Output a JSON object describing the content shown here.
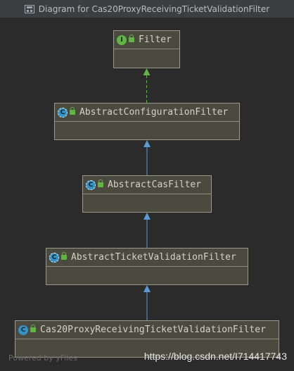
{
  "window": {
    "title": "Diagram for Cas20ProxyReceivingTicketValidationFilter"
  },
  "nodes": [
    {
      "id": "filter",
      "name": "Filter",
      "kind": "interface",
      "badge": "I"
    },
    {
      "id": "acf",
      "name": "AbstractConfigurationFilter",
      "kind": "abstract",
      "badge": "C"
    },
    {
      "id": "acasf",
      "name": "AbstractCasFilter",
      "kind": "abstract",
      "badge": "C"
    },
    {
      "id": "atvf",
      "name": "AbstractTicketValidationFilter",
      "kind": "abstract",
      "badge": "C"
    },
    {
      "id": "c20",
      "name": "Cas20ProxyReceivingTicketValidationFilter",
      "kind": "class",
      "badge": "C"
    }
  ],
  "edges": [
    {
      "from": "acf",
      "to": "filter",
      "type": "implements",
      "color": "#62b543"
    },
    {
      "from": "acasf",
      "to": "acf",
      "type": "extends",
      "color": "#5b9bd5"
    },
    {
      "from": "atvf",
      "to": "acasf",
      "type": "extends",
      "color": "#5b9bd5"
    },
    {
      "from": "c20",
      "to": "atvf",
      "type": "extends",
      "color": "#5b9bd5"
    }
  ],
  "watermark": {
    "powered_by": "Powered by yFiles",
    "url": "https://blog.csdn.net/I714417743"
  },
  "colors": {
    "background": "#2b2b2b",
    "node_fill": "#4b4a3f",
    "node_border": "#9a9888",
    "node_text": "#d4d3c6"
  }
}
